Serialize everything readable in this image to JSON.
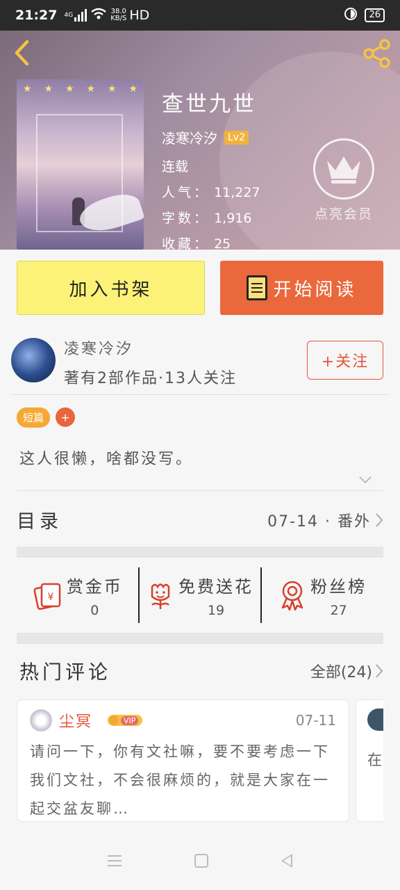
{
  "status_bar": {
    "time": "21:27",
    "network": "4G",
    "speed_value": "38.0",
    "speed_unit": "KB/S",
    "hd": "HD",
    "battery": "26"
  },
  "book": {
    "title": "查世九世",
    "author": "凌寒冷汐",
    "author_level": "Lv2",
    "status": "连载",
    "popularity_label": "人气：",
    "popularity": "11,227",
    "words_label": "字数：",
    "words": "1,916",
    "favorites_label": "收藏：",
    "favorites": "25",
    "vip_label": "点亮会员"
  },
  "buttons": {
    "add_shelf": "加入书架",
    "start_read": "开始阅读"
  },
  "author_section": {
    "name": "凌寒冷汐",
    "meta": "著有2部作品·13人关注",
    "follow": "+关注"
  },
  "tags": {
    "items": [
      "短篇"
    ],
    "add": "+"
  },
  "intro": "这人很懒，啥都没写。",
  "toc": {
    "title": "目录",
    "latest": "07-14 · 番外"
  },
  "actions": [
    {
      "label": "赏金币",
      "count": "0",
      "icon": "red-envelope-icon"
    },
    {
      "label": "免费送花",
      "count": "19",
      "icon": "flower-icon"
    },
    {
      "label": "粉丝榜",
      "count": "27",
      "icon": "rosette-icon"
    }
  ],
  "comments": {
    "title": "热门评论",
    "all_label": "全部(24)",
    "items": [
      {
        "user": "尘冥",
        "vip": "VIP",
        "date": "07-11",
        "text": "请问一下，你有文社嘛，要不要考虑一下我们文社，不会很麻烦的，就是大家在一起交盆友聊…"
      },
      {
        "text": "在"
      }
    ]
  },
  "colors": {
    "accent": "#e9653e",
    "shelf_button": "#fbf277",
    "level_badge": "#f2b33d"
  }
}
